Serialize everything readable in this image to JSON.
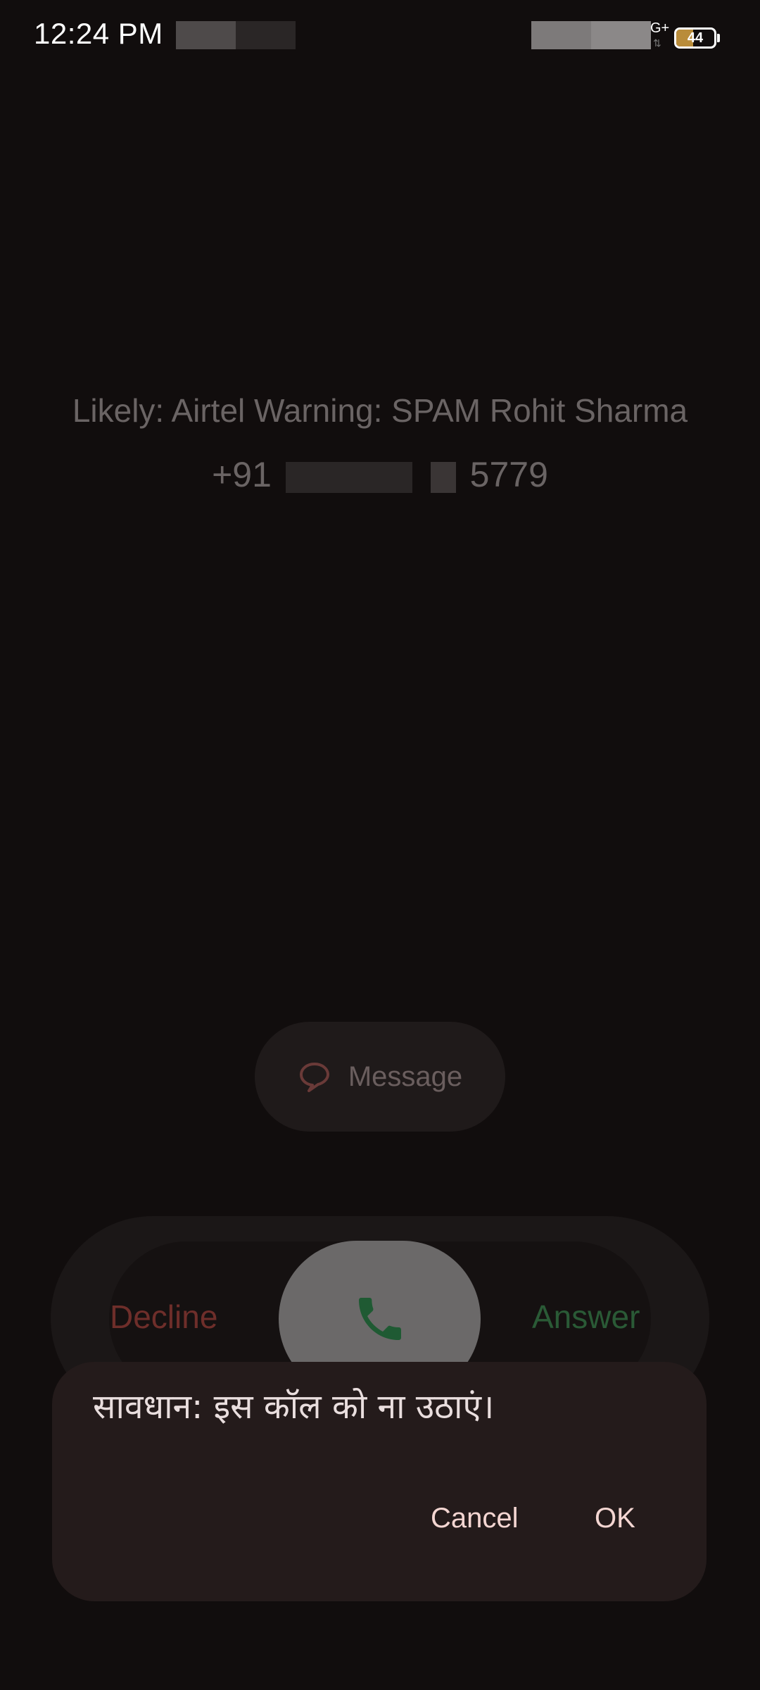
{
  "status_bar": {
    "time": "12:24 PM",
    "network_type": "G+",
    "battery_level": "44",
    "battery_fraction": 0.44
  },
  "caller": {
    "name": "Likely: Airtel Warning: SPAM Rohit Sharma",
    "number_prefix": "+91",
    "number_suffix": "5779"
  },
  "actions": {
    "message_label": "Message",
    "decline_label": "Decline",
    "answer_label": "Answer"
  },
  "dialog": {
    "title": "सावधान: इस कॉल को ना उठाएं।",
    "cancel_label": "Cancel",
    "ok_label": "OK"
  },
  "colors": {
    "background": "#110d0d",
    "decline": "#6e2e2a",
    "answer": "#2a5a36",
    "dialog_bg": "#241b1b",
    "dialog_button": "#f4d6d2"
  },
  "icons": {
    "message": "chat-bubble-icon",
    "answer": "phone-icon",
    "battery": "battery-icon"
  }
}
